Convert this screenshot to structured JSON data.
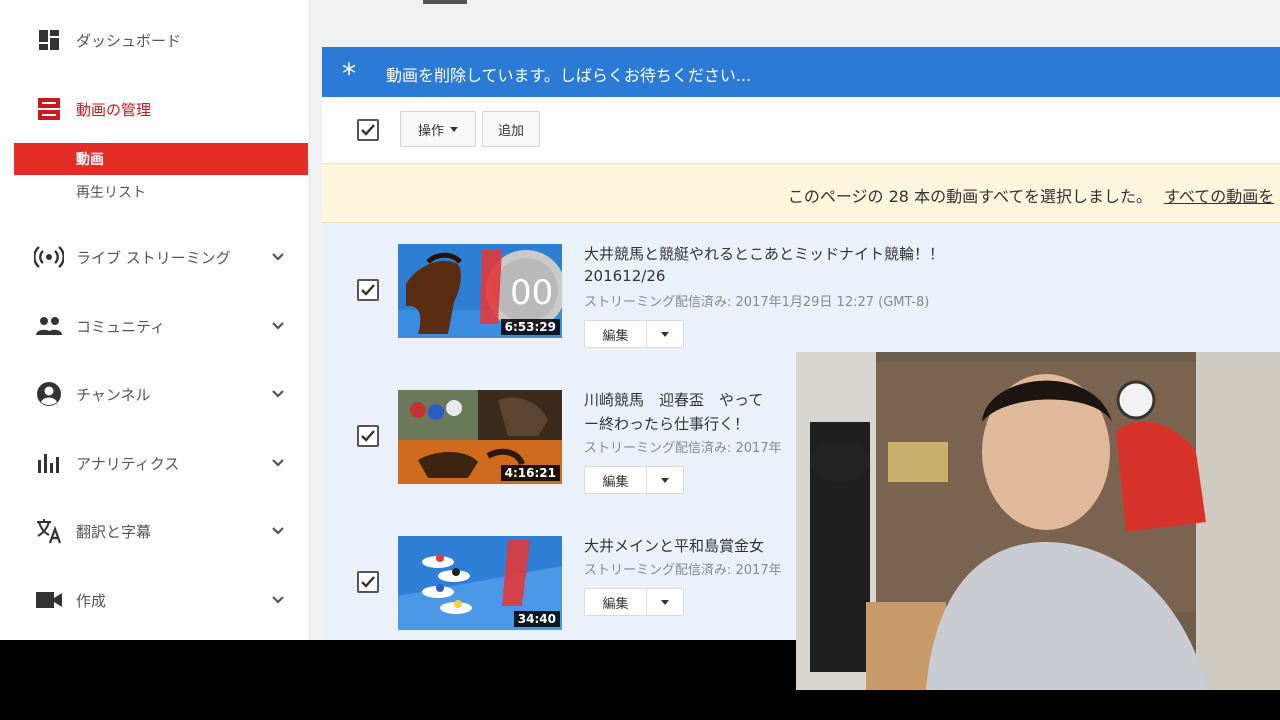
{
  "sidebar": {
    "items": [
      {
        "label": "ダッシュボード"
      },
      {
        "label": "動画の管理"
      },
      {
        "label": "ライブ ストリーミング"
      },
      {
        "label": "コミュニティ"
      },
      {
        "label": "チャンネル"
      },
      {
        "label": "アナリティクス"
      },
      {
        "label": "翻訳と字幕"
      },
      {
        "label": "作成"
      }
    ],
    "sub_items": [
      {
        "label": "動画"
      },
      {
        "label": "再生リスト"
      }
    ]
  },
  "banner": {
    "message": "動画を削除しています。しばらくお待ちください..."
  },
  "toolbar": {
    "actions_label": "操作",
    "add_label": "追加"
  },
  "notice": {
    "text": "このページの 28 本の動画すべてを選択しました。",
    "link": "すべての動画を"
  },
  "videos": [
    {
      "title": "大井競馬と競艇やれるとこあとミッドナイト競輪！！",
      "title2": "201612/26",
      "status": "ストリーミング配信済み: 2017年1月29日 12:27 (GMT-8)",
      "duration": "6:53:29",
      "edit_label": "編集"
    },
    {
      "title": "川崎競馬　迎春盃　やって",
      "title2": "ー終わったら仕事行く！",
      "status": "ストリーミング配信済み: 2017年",
      "duration": "4:16:21",
      "edit_label": "編集"
    },
    {
      "title": "大井メインと平和島賞金女",
      "status": "ストリーミング配信済み: 2017年",
      "duration": "34:40",
      "edit_label": "編集"
    }
  ],
  "colors": {
    "accent_red": "#e52d27",
    "banner_blue": "#2b7bd6",
    "notice_yellow": "#fdf6dc",
    "list_bg": "#eaf1fb"
  }
}
